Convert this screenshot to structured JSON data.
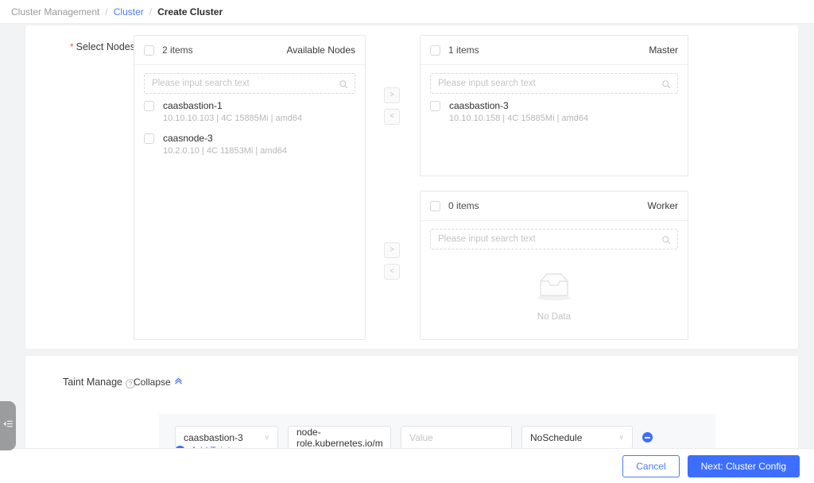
{
  "breadcrumb": {
    "root": "Cluster Management",
    "parent": "Cluster",
    "current": "Create Cluster",
    "separator": "/"
  },
  "select_nodes": {
    "label": "Select Nodes",
    "required_mark": "*",
    "available": {
      "title": "Available Nodes",
      "count_label": "2 items",
      "search_placeholder": "Please input search text",
      "nodes": [
        {
          "name": "caasbastion-1",
          "meta": "10.10.10.103 | 4C 15885Mi | amd64"
        },
        {
          "name": "caasnode-3",
          "meta": "10.2.0.10 | 4C 11853Mi | amd64"
        }
      ]
    },
    "master": {
      "title": "Master",
      "count_label": "1 items",
      "search_placeholder": "Please input search text",
      "nodes": [
        {
          "name": "caasbastion-3",
          "meta": "10.10.10.158 | 4C 15885Mi | amd64"
        }
      ]
    },
    "worker": {
      "title": "Worker",
      "count_label": "0 items",
      "search_placeholder": "Please input search text",
      "nodes": [],
      "empty_text": "No Data"
    },
    "transfer": {
      "move_right": ">",
      "move_left": "<"
    }
  },
  "taint": {
    "label": "Taint Manage",
    "help_glyph": "?",
    "collapse_label": "Collapse",
    "collapse_glyph": "⌃",
    "rows": [
      {
        "node": "caasbastion-3",
        "key": "node-role.kubernetes.io/m",
        "value": "",
        "value_placeholder": "Value",
        "effect": "NoSchedule"
      }
    ],
    "add_label": "Add Taints",
    "select_caret": "∨"
  },
  "footer": {
    "cancel": "Cancel",
    "next": "Next: Cluster Config"
  },
  "colors": {
    "accent": "#3d6eff",
    "link": "#4a7bf7",
    "required": "#f5554a",
    "page_bg": "#f2f3f5"
  }
}
